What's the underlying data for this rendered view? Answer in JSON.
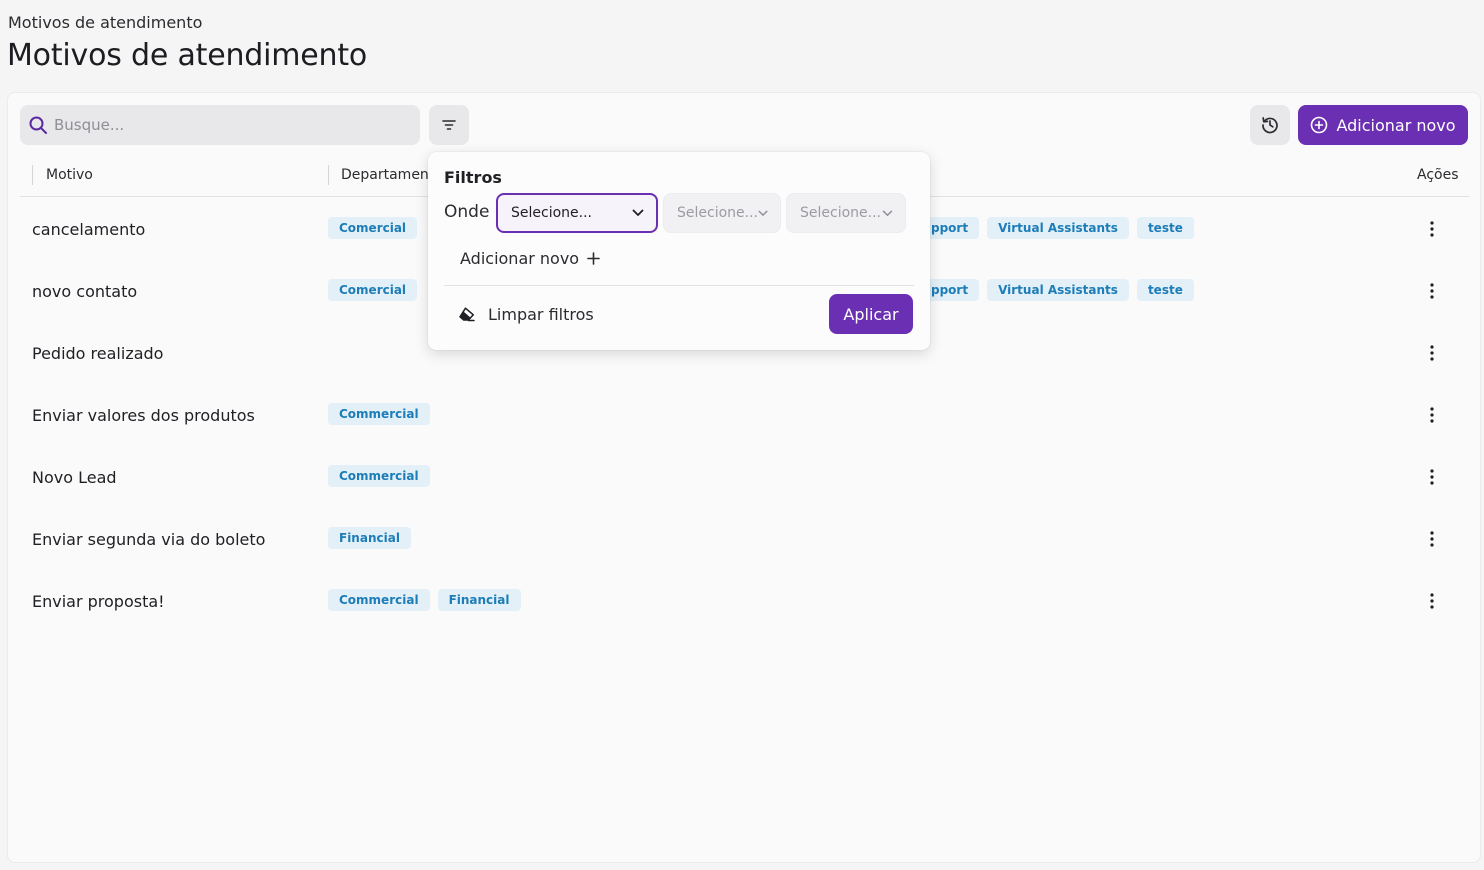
{
  "breadcrumb": "Motivos de atendimento",
  "page_title": "Motivos de atendimento",
  "toolbar": {
    "search_placeholder": "Busque...",
    "add_label": "Adicionar novo"
  },
  "table": {
    "headers": {
      "motivo": "Motivo",
      "departamento": "Departament",
      "acoes": "Ações"
    },
    "rows": [
      {
        "motivo": "cancelamento",
        "tags": [
          "Comercial"
        ],
        "tags_right": [
          "pport",
          "Virtual Assistants",
          "teste"
        ]
      },
      {
        "motivo": "novo contato",
        "tags": [
          "Comercial"
        ],
        "tags_right": [
          "pport",
          "Virtual Assistants",
          "teste"
        ]
      },
      {
        "motivo": "Pedido realizado",
        "tags": [],
        "tags_right": []
      },
      {
        "motivo": "Enviar valores dos produtos",
        "tags": [
          "Commercial"
        ],
        "tags_right": []
      },
      {
        "motivo": "Novo Lead",
        "tags": [
          "Commercial"
        ],
        "tags_right": []
      },
      {
        "motivo": "Enviar segunda via do boleto",
        "tags": [
          "Financial"
        ],
        "tags_right": []
      },
      {
        "motivo": "Enviar proposta!",
        "tags": [
          "Commercial",
          "Financial"
        ],
        "tags_right": []
      }
    ]
  },
  "filter_popover": {
    "title": "Filtros",
    "where_label": "Onde",
    "select_1": "Selecione...",
    "select_2": "Selecione...",
    "select_3": "Selecione...",
    "add_label": "Adicionar novo",
    "clear_label": "Limpar filtros",
    "apply_label": "Aplicar"
  },
  "colors": {
    "accent": "#6b2fb3",
    "tag_bg": "#e3f0f8",
    "tag_text": "#1d7db8"
  },
  "icons": {
    "search": "search-icon",
    "filter": "filter-icon",
    "history": "history-icon",
    "add": "plus-circle-icon",
    "chevron": "chevron-down-icon",
    "plus": "plus-icon",
    "eraser": "eraser-icon",
    "kebab": "kebab-menu-icon"
  }
}
